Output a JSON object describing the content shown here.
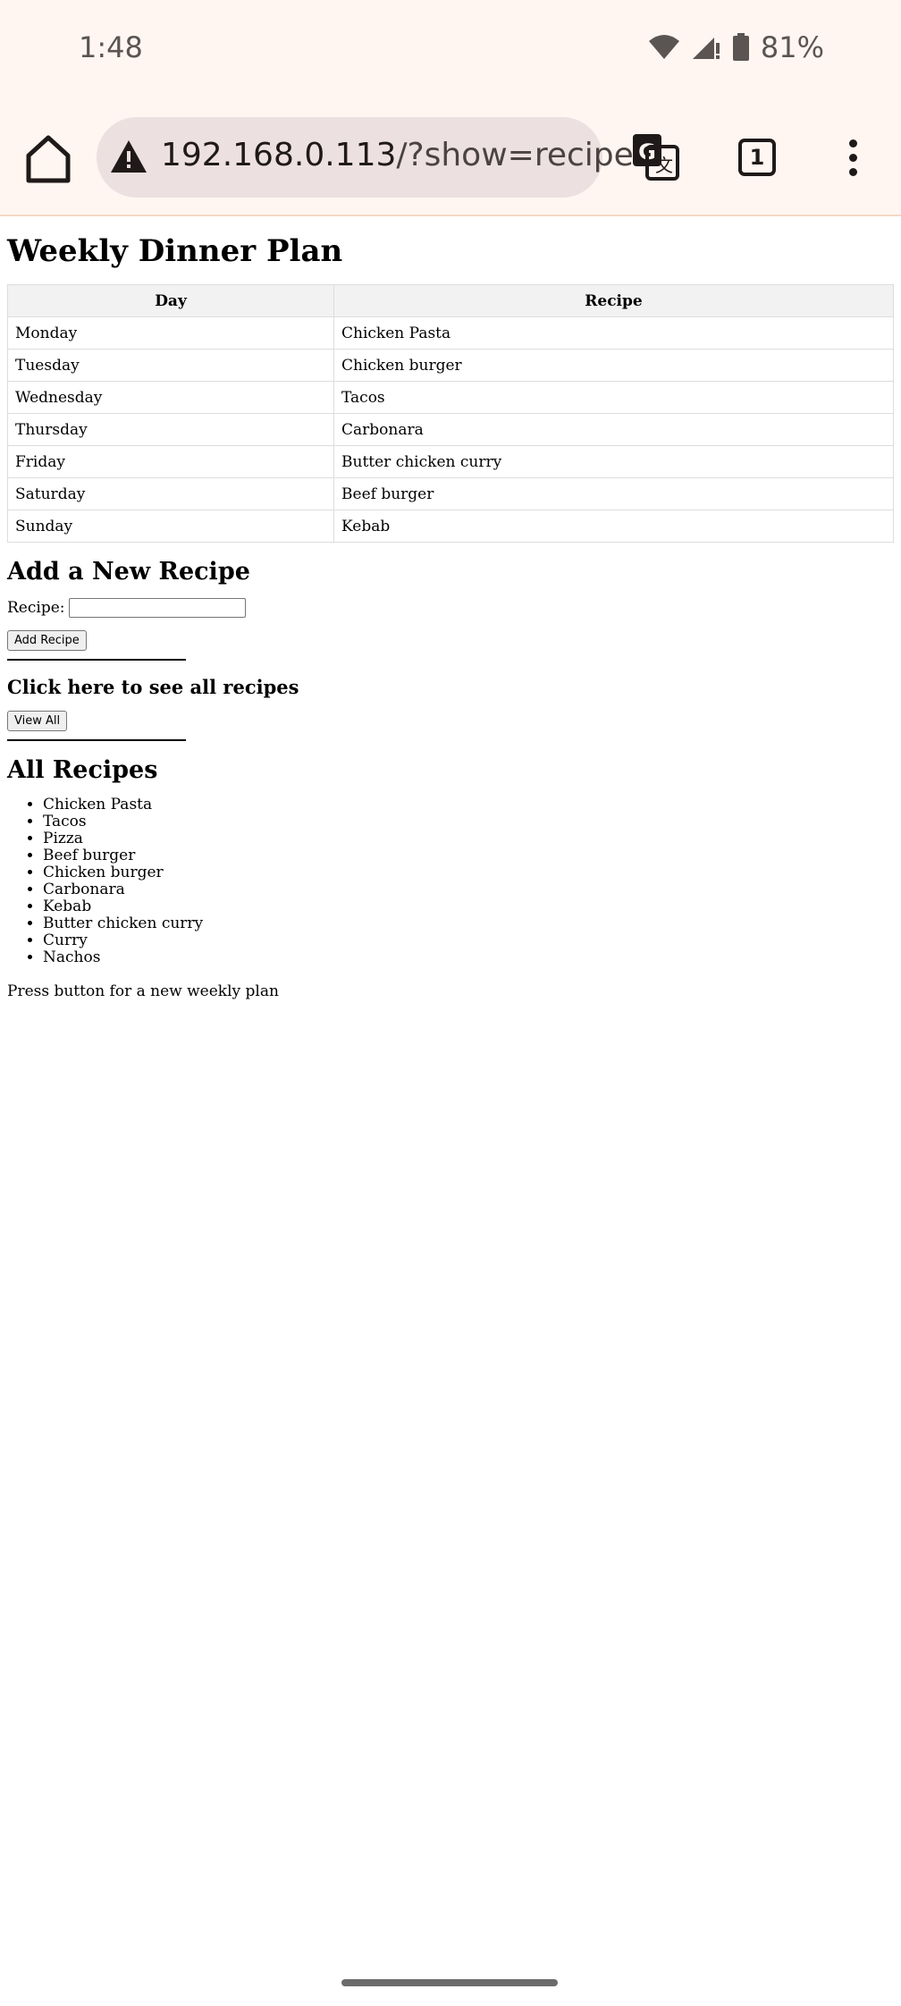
{
  "status": {
    "time": "1:48",
    "battery": "81%"
  },
  "browser": {
    "url_host": "192.168.0.113",
    "url_path": "/?show=recipes"
  },
  "page": {
    "title": "Weekly Dinner Plan",
    "table": {
      "headers": [
        "Day",
        "Recipe"
      ],
      "rows": [
        [
          "Monday",
          "Chicken Pasta"
        ],
        [
          "Tuesday",
          "Chicken burger"
        ],
        [
          "Wednesday",
          "Tacos"
        ],
        [
          "Thursday",
          "Carbonara"
        ],
        [
          "Friday",
          "Butter chicken curry"
        ],
        [
          "Saturday",
          "Beef burger"
        ],
        [
          "Sunday",
          "Kebab"
        ]
      ]
    },
    "add_section": {
      "heading": "Add a New Recipe",
      "label": "Recipe:",
      "input_value": "",
      "button": "Add Recipe"
    },
    "view_section": {
      "heading": "Click here to see all recipes",
      "button": "View All"
    },
    "all_section": {
      "heading": "All Recipes",
      "items": [
        "Chicken Pasta",
        "Tacos",
        "Pizza",
        "Beef burger",
        "Chicken burger",
        "Carbonara",
        "Kebab",
        "Butter chicken curry",
        "Curry",
        "Nachos"
      ]
    },
    "footer_text": "Press button for a new weekly plan"
  }
}
